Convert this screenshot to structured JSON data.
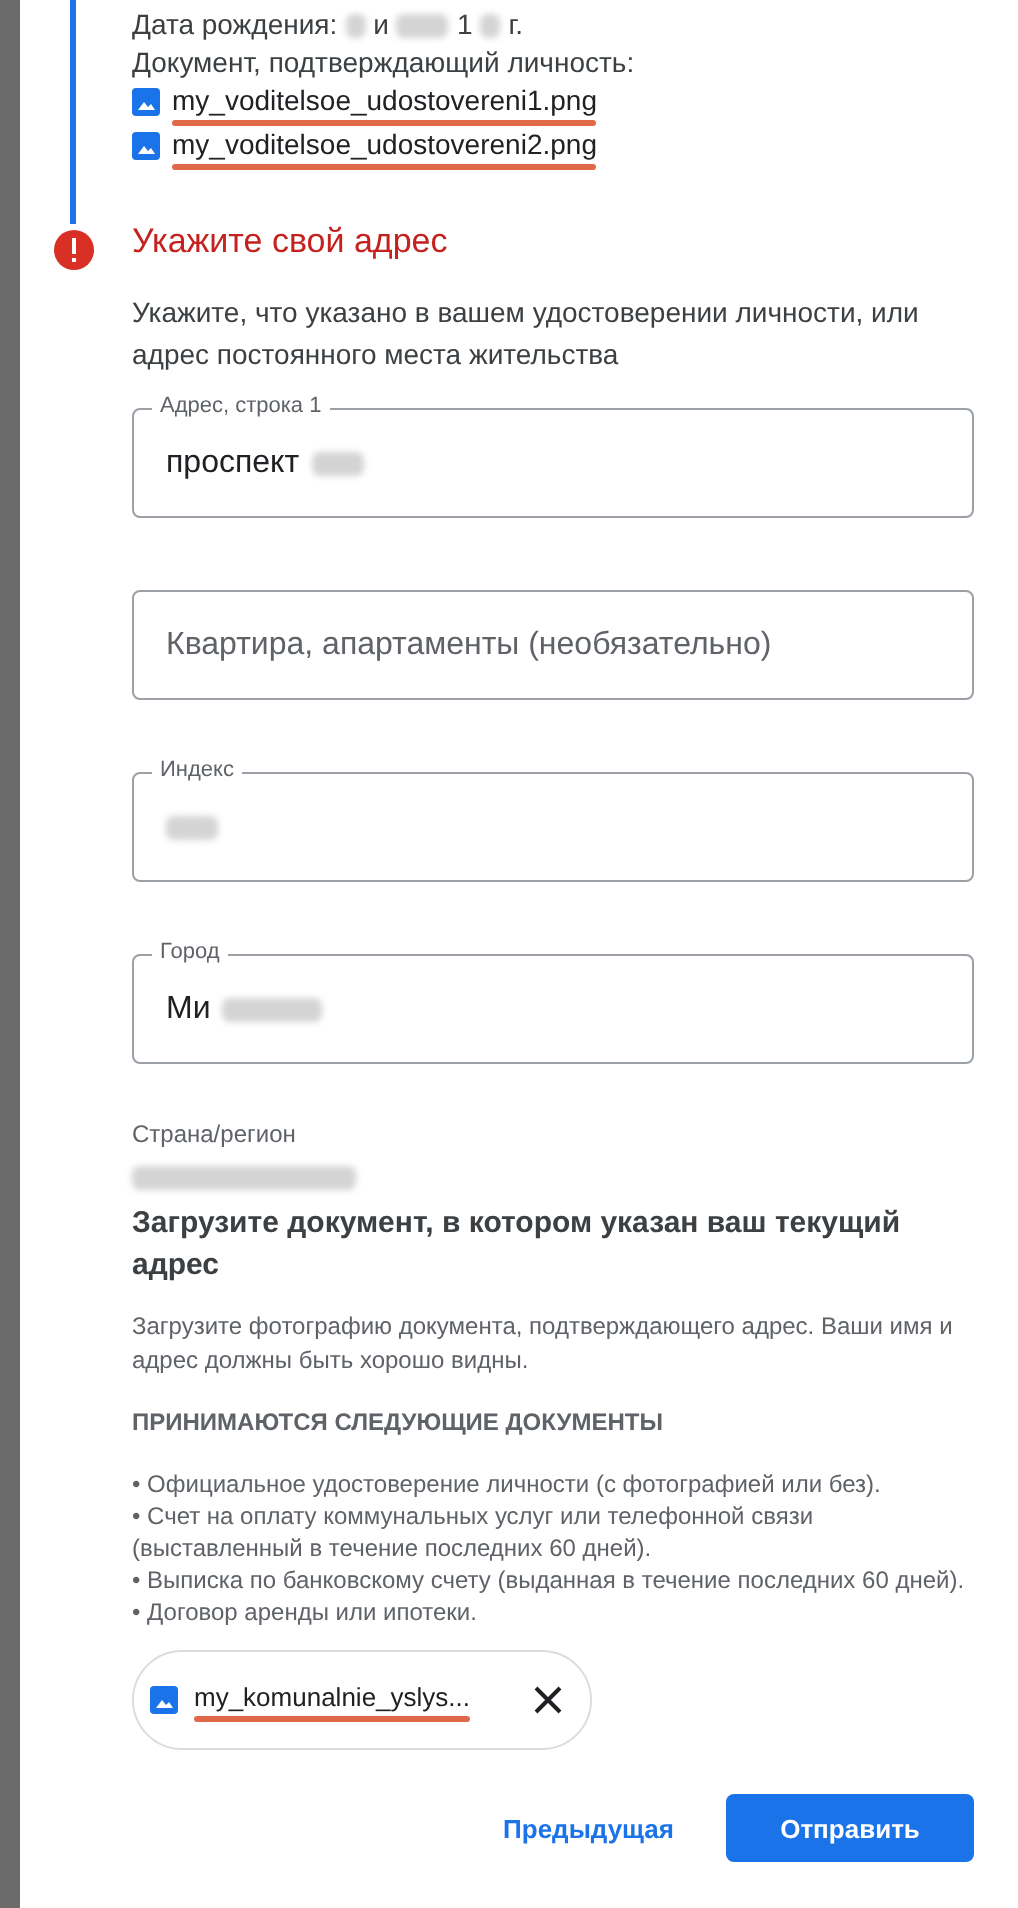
{
  "summary": {
    "birth_label": "Дата рождения:",
    "birth_parts": [
      {
        "kind": "blur_short"
      },
      {
        "kind": "text",
        "text": "и"
      },
      {
        "kind": "blur"
      },
      {
        "kind": "text",
        "text": "1"
      },
      {
        "kind": "blur_short"
      },
      {
        "kind": "text",
        "text": "г."
      }
    ],
    "document_label": "Документ, подтверждающий личность:",
    "files": [
      "my_voditelsoe_udostovereni1.png",
      "my_voditelsoe_udostovereni2.png"
    ]
  },
  "step": {
    "title": "Укажите свой адрес",
    "error": true,
    "description": "Укажите, что указано в вашем удостоверении личности, или адрес постоянного места жительства"
  },
  "fields": [
    {
      "label": "Адрес, строка 1",
      "parts": [
        {
          "kind": "text",
          "text": "проспект"
        },
        {
          "kind": "blur"
        }
      ]
    },
    {
      "placeholder": "Квартира, апартаменты (необязательно)"
    },
    {
      "label": "Индекс",
      "parts": [
        {
          "kind": "blur"
        }
      ]
    },
    {
      "label": "Город",
      "parts": [
        {
          "kind": "text",
          "text": "Ми"
        },
        {
          "kind": "blur_long"
        }
      ]
    }
  ],
  "country": {
    "label": "Страна/регион",
    "parts": [
      {
        "kind": "blur_wide"
      }
    ]
  },
  "upload": {
    "title": "Загрузите документ, в котором указан ваш текущий адрес",
    "hint": "Загрузите фотографию документа, подтверждающего адрес. Ваши имя и адрес должны быть хорошо видны.",
    "accepted_heading": "ПРИНИМАЮТСЯ СЛЕДУЮЩИЕ ДОКУМЕНТЫ",
    "accepted": [
      "• Официальное удостоверение личности (с фотографией или без).",
      "• Счет на оплату коммунальных услуг или телефонной связи (выставленный в течение последних 60 дней).",
      "• Выписка по банковскому счету (выданная в течение последних 60 дней).",
      "• Договор аренды или ипотеки."
    ],
    "file_chip": "my_komunalnie_yslys..."
  },
  "buttons": [
    {
      "label": "Предыдущая",
      "kind": "text"
    },
    {
      "label": "Отправить",
      "kind": "primary"
    }
  ]
}
